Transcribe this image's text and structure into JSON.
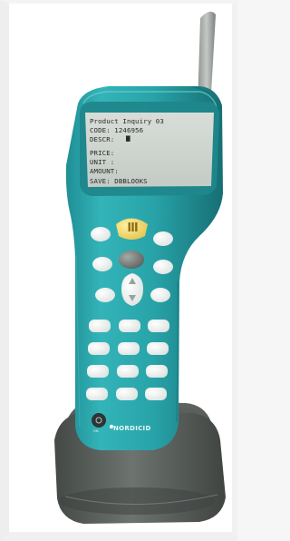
{
  "screen": {
    "lines": [
      "Product Inquiry 03",
      "CODE: 1246956",
      "DESCR: ",
      "PRICE:",
      "UNIT :",
      "AMOUNT:",
      "SAVE: DBBLOOKS"
    ]
  },
  "device": {
    "brand_label": "NORDICID"
  },
  "colors": {
    "housing": "#2aa8ad",
    "cradle": "#5f6460",
    "keys": "#f3f6f4",
    "screen": "#c9cfc9"
  }
}
